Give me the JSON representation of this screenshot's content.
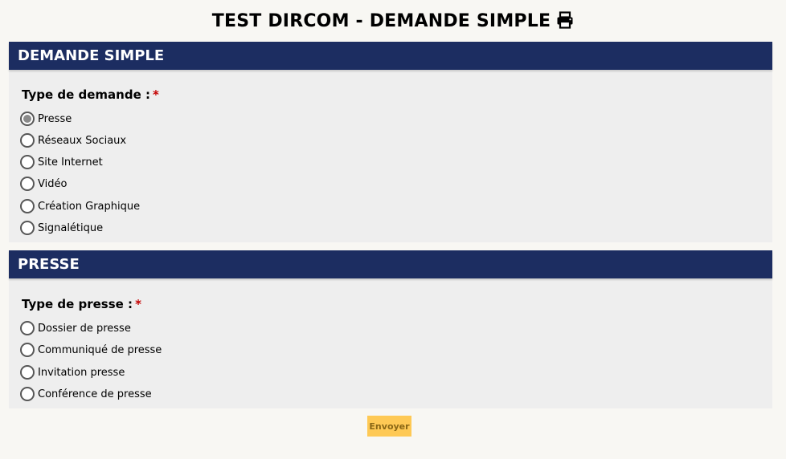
{
  "page": {
    "title": "TEST DIRCOM - DEMANDE SIMPLE"
  },
  "sections": [
    {
      "header": "DEMANDE SIMPLE",
      "field_label": "Type de demande :",
      "required_mark": "*",
      "options": [
        {
          "label": "Presse",
          "selected": true
        },
        {
          "label": "Réseaux Sociaux",
          "selected": false
        },
        {
          "label": "Site Internet",
          "selected": false
        },
        {
          "label": "Vidéo",
          "selected": false
        },
        {
          "label": "Création Graphique",
          "selected": false
        },
        {
          "label": "Signalétique",
          "selected": false
        }
      ]
    },
    {
      "header": "PRESSE",
      "field_label": "Type de presse :",
      "required_mark": "*",
      "options": [
        {
          "label": "Dossier de presse",
          "selected": false
        },
        {
          "label": "Communiqué de presse",
          "selected": false
        },
        {
          "label": "Invitation presse",
          "selected": false
        },
        {
          "label": "Conférence de presse",
          "selected": false
        }
      ]
    }
  ],
  "form": {
    "submit_label": "Envoyer"
  },
  "colors": {
    "header_bg": "#1c2d61",
    "section_bg": "#eeeeee",
    "page_bg": "#f8f7f3",
    "required": "#c40000",
    "submit_bg": "#fec955",
    "submit_text": "#8a6715"
  },
  "icons": {
    "title_icon": "print-icon"
  }
}
